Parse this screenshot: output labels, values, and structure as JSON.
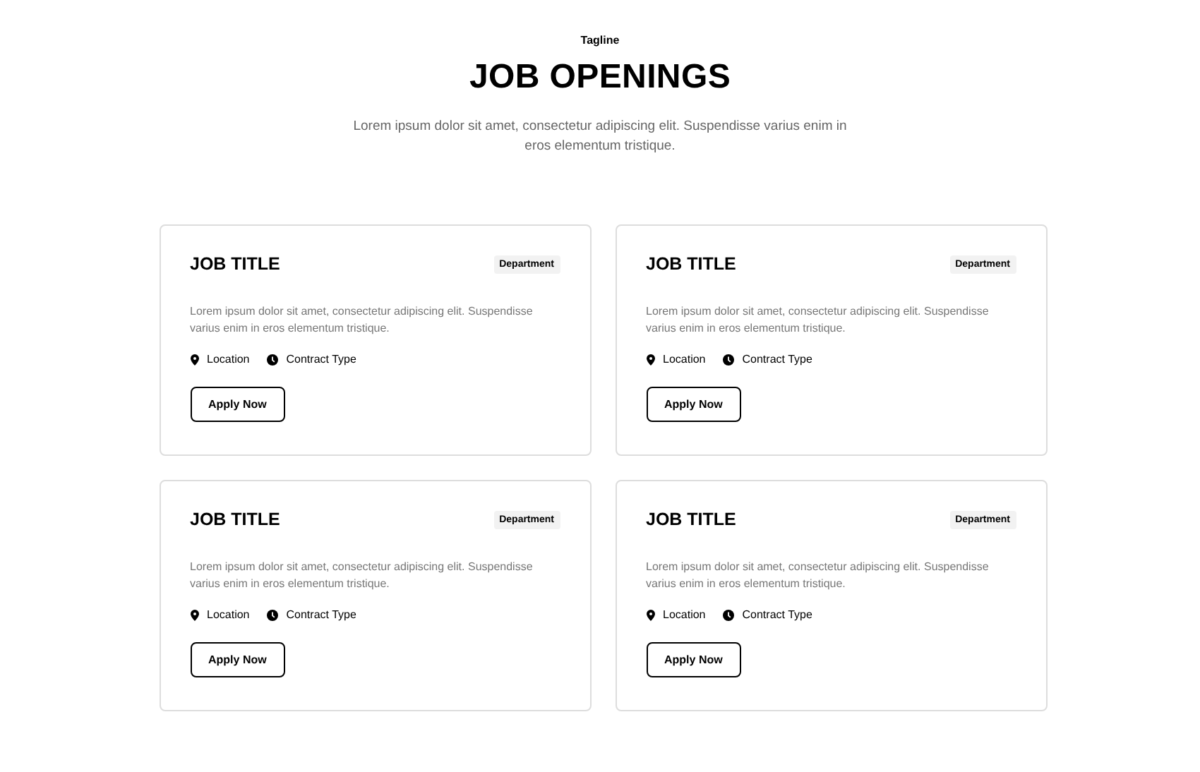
{
  "header": {
    "tagline": "Tagline",
    "title": "JOB OPENINGS",
    "subtitle": "Lorem ipsum dolor sit amet, consectetur adipiscing elit. Suspendisse varius enim in eros elementum tristique."
  },
  "jobs": [
    {
      "title": "JOB TITLE",
      "department": "Department",
      "description": "Lorem ipsum dolor sit amet, consectetur adipiscing elit. Suspendisse varius enim in eros elementum tristique.",
      "location": "Location",
      "contract": "Contract Type",
      "button": "Apply Now"
    },
    {
      "title": "JOB TITLE",
      "department": "Department",
      "description": "Lorem ipsum dolor sit amet, consectetur adipiscing elit. Suspendisse varius enim in eros elementum tristique.",
      "location": "Location",
      "contract": "Contract Type",
      "button": "Apply Now"
    },
    {
      "title": "JOB TITLE",
      "department": "Department",
      "description": "Lorem ipsum dolor sit amet, consectetur adipiscing elit. Suspendisse varius enim in eros elementum tristique.",
      "location": "Location",
      "contract": "Contract Type",
      "button": "Apply Now"
    },
    {
      "title": "JOB TITLE",
      "department": "Department",
      "description": "Lorem ipsum dolor sit amet, consectetur adipiscing elit. Suspendisse varius enim in eros elementum tristique.",
      "location": "Location",
      "contract": "Contract Type",
      "button": "Apply Now"
    }
  ]
}
